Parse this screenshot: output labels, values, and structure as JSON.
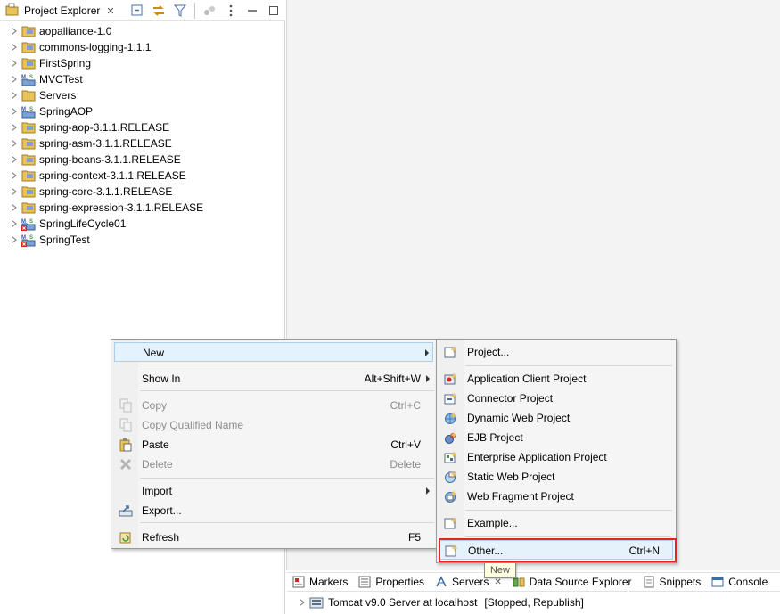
{
  "explorer": {
    "title": "Project Explorer",
    "close_glyph": "✕",
    "toolbar": [
      "collapse-all-icon",
      "link-editor-icon",
      "filter-icon",
      "focus-icon",
      "view-menu-icon",
      "minimize-icon",
      "maximize-icon"
    ],
    "projects": [
      {
        "label": "aopalliance-1.0",
        "icon": "folder-project-icon"
      },
      {
        "label": "commons-logging-1.1.1",
        "icon": "folder-project-icon"
      },
      {
        "label": "FirstSpring",
        "icon": "folder-project-icon"
      },
      {
        "label": "MVCTest",
        "icon": "maven-spring-project-icon"
      },
      {
        "label": "Servers",
        "icon": "folder-project-icon"
      },
      {
        "label": "SpringAOP",
        "icon": "maven-spring-project-icon"
      },
      {
        "label": "spring-aop-3.1.1.RELEASE",
        "icon": "folder-project-icon"
      },
      {
        "label": "spring-asm-3.1.1.RELEASE",
        "icon": "folder-project-icon"
      },
      {
        "label": "spring-beans-3.1.1.RELEASE",
        "icon": "folder-project-icon"
      },
      {
        "label": "spring-context-3.1.1.RELEASE",
        "icon": "folder-project-icon"
      },
      {
        "label": "spring-core-3.1.1.RELEASE",
        "icon": "folder-project-icon"
      },
      {
        "label": "spring-expression-3.1.1.RELEASE",
        "icon": "folder-project-icon"
      },
      {
        "label": "SpringLifeCycle01",
        "icon": "maven-spring-error-project-icon"
      },
      {
        "label": "SpringTest",
        "icon": "maven-spring-error-project-icon"
      }
    ]
  },
  "context_menu": {
    "new": {
      "label": "New"
    },
    "show_in": {
      "label": "Show In",
      "shortcut": "Alt+Shift+W"
    },
    "copy": {
      "label": "Copy",
      "shortcut": "Ctrl+C"
    },
    "copy_qualified": {
      "label": "Copy Qualified Name"
    },
    "paste": {
      "label": "Paste",
      "shortcut": "Ctrl+V"
    },
    "delete": {
      "label": "Delete",
      "shortcut": "Delete"
    },
    "import": {
      "label": "Import"
    },
    "export": {
      "label": "Export..."
    },
    "refresh": {
      "label": "Refresh",
      "shortcut": "F5"
    }
  },
  "sub_menu": {
    "project": {
      "label": "Project..."
    },
    "app_client": {
      "label": "Application Client Project"
    },
    "connector": {
      "label": "Connector Project"
    },
    "dynamic_web": {
      "label": "Dynamic Web Project"
    },
    "ejb": {
      "label": "EJB Project"
    },
    "enterprise_app": {
      "label": "Enterprise Application Project"
    },
    "static_web": {
      "label": "Static Web Project"
    },
    "web_fragment": {
      "label": "Web Fragment Project"
    },
    "example": {
      "label": "Example..."
    },
    "other": {
      "label": "Other...",
      "shortcut": "Ctrl+N"
    }
  },
  "tooltip": "New",
  "bottom_tabs": [
    {
      "label": "Markers",
      "icon": "markers-icon"
    },
    {
      "label": "Properties",
      "icon": "properties-icon"
    },
    {
      "label": "Servers",
      "icon": "servers-icon",
      "active": true
    },
    {
      "label": "Data Source Explorer",
      "icon": "data-source-icon"
    },
    {
      "label": "Snippets",
      "icon": "snippets-icon"
    },
    {
      "label": "Console",
      "icon": "console-icon"
    }
  ],
  "server": {
    "name": "Tomcat v9.0 Server at localhost",
    "status": "[Stopped, Republish]"
  },
  "colors": {
    "highlight_border": "#e8221c",
    "menu_hover": "#e5f1fb",
    "folder_yellow": "#e8c25a"
  }
}
